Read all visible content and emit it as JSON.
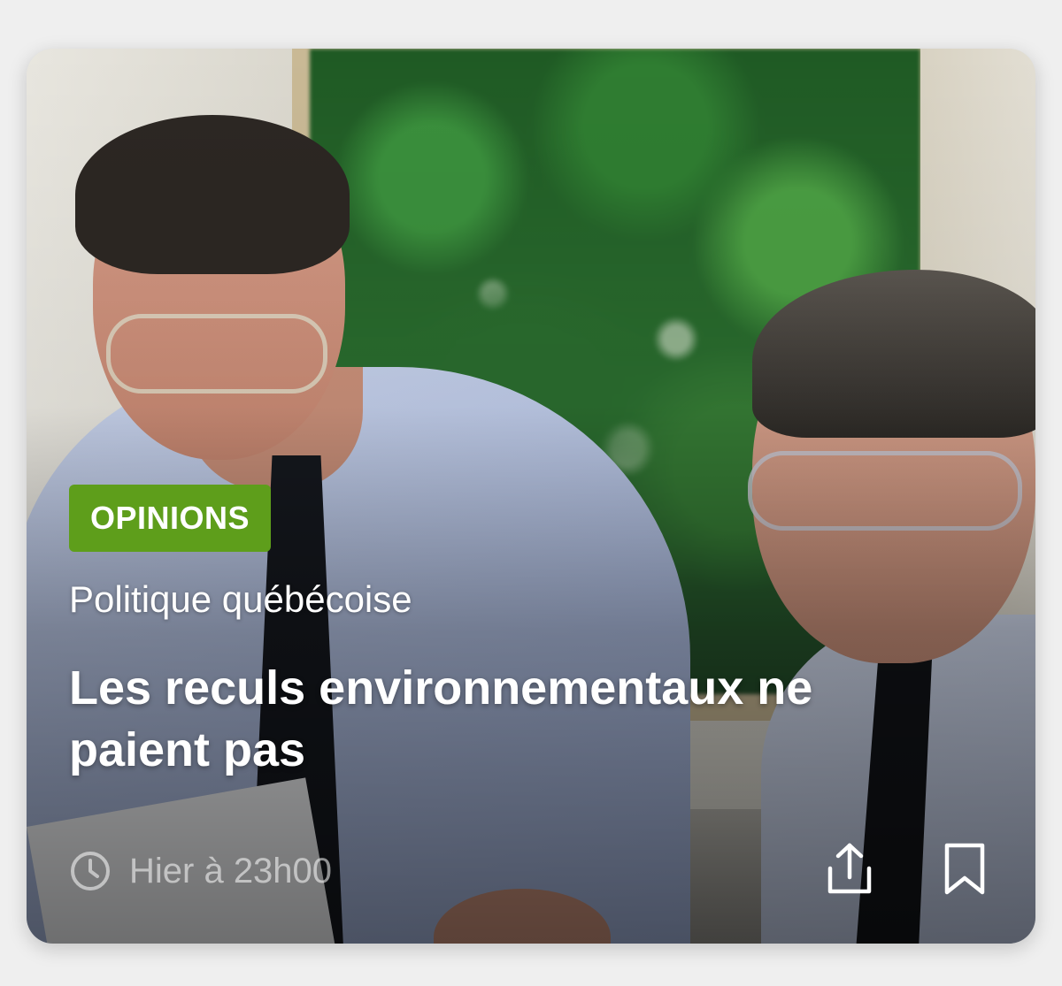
{
  "card": {
    "category_badge": "OPINIONS",
    "section": "Politique québécoise",
    "headline": "Les reculs environnementaux ne paient pas",
    "timestamp": "Hier à 23h00",
    "badge_color": "#5e9e1b",
    "icons": {
      "time": "clock-icon",
      "share": "share-icon",
      "bookmark": "bookmark-icon"
    }
  }
}
